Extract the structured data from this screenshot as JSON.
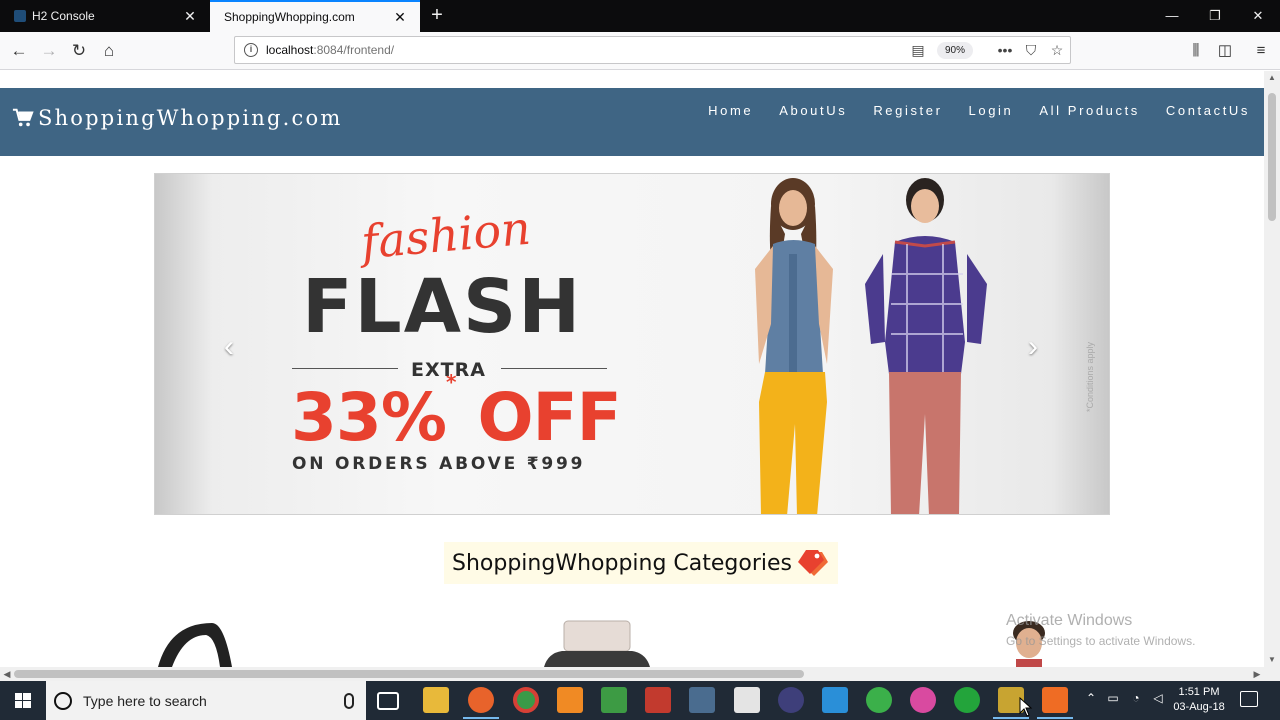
{
  "browser": {
    "tabs": [
      {
        "title": "H2 Console",
        "active": false
      },
      {
        "title": "ShoppingWhopping.com",
        "active": true
      }
    ],
    "url_host": "localhost",
    "url_rest": ":8084/frontend/",
    "zoom": "90%"
  },
  "site": {
    "brand": "ShoppingWhopping.com",
    "menu": [
      "Home",
      "AboutUs",
      "Register",
      "Login",
      "All Products",
      "ContactUs"
    ],
    "colors": {
      "header": "#3f6584",
      "accent": "#e8412f"
    }
  },
  "carousel": {
    "fashion": "fashion",
    "flash": "FLASH",
    "extra": "EXTRA",
    "discount": "33%",
    "asterisk": "*",
    "off": "OFF",
    "orders": "ON ORDERS ABOVE ₹999",
    "conditions": "*Conditions apply"
  },
  "categories": {
    "heading": "ShoppingWhopping Categories"
  },
  "watermark": {
    "line1": "Activate Windows",
    "line2": "Go to Settings to activate Windows."
  },
  "taskbar": {
    "search_placeholder": "Type here to search",
    "time": "1:51 PM",
    "date": "03-Aug-18"
  }
}
